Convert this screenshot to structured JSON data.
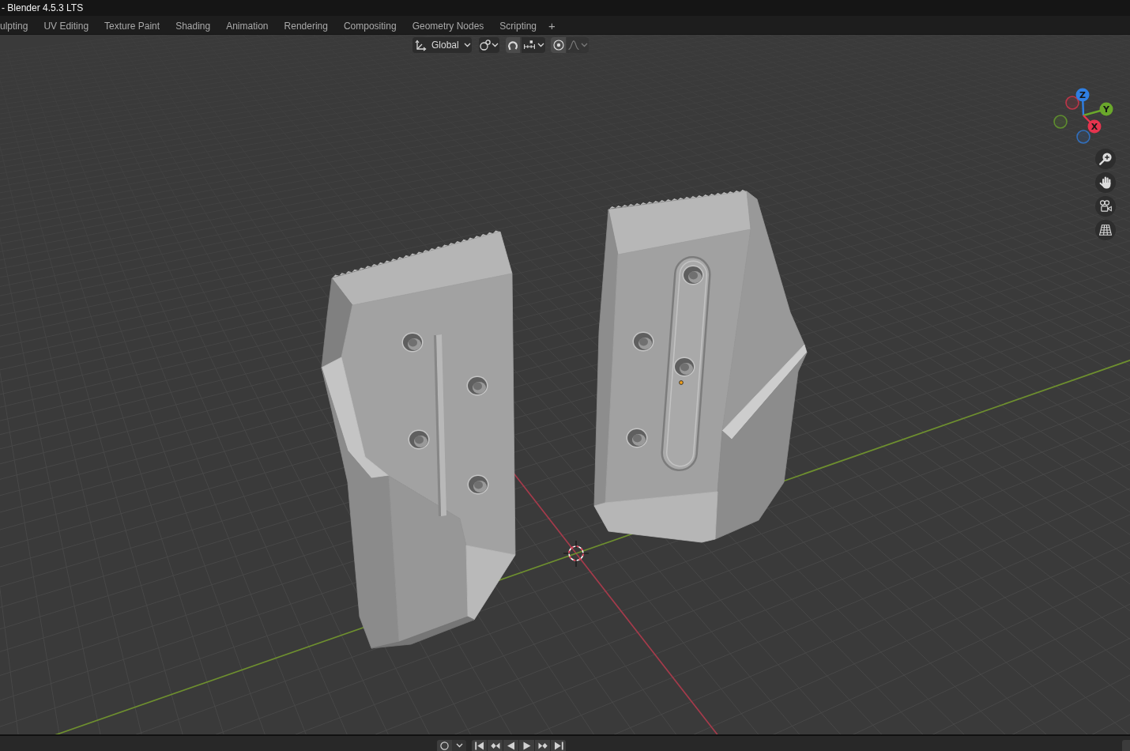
{
  "window": {
    "title": "- Blender 4.5.3 LTS"
  },
  "workspace_tabs": [
    {
      "label": "ulpting",
      "selected": false
    },
    {
      "label": "UV Editing",
      "selected": false
    },
    {
      "label": "Texture Paint",
      "selected": false
    },
    {
      "label": "Shading",
      "selected": false
    },
    {
      "label": "Animation",
      "selected": false
    },
    {
      "label": "Rendering",
      "selected": false
    },
    {
      "label": "Compositing",
      "selected": false
    },
    {
      "label": "Geometry Nodes",
      "selected": false
    },
    {
      "label": "Scripting",
      "selected": false
    }
  ],
  "add_workspace": {
    "label": "+"
  },
  "viewport_header": {
    "tools": [
      {
        "kind": "dropdown",
        "label": "Global",
        "disabled": false
      },
      {
        "kind": "dropdown",
        "disabled": false
      },
      {
        "kind": "toggle",
        "on": false,
        "disabled": false
      },
      {
        "kind": "dropdown",
        "disabled": false
      },
      {
        "kind": "toggle",
        "on": false,
        "disabled": false
      },
      {
        "kind": "dropdown",
        "disabled": true
      }
    ]
  },
  "navigation_gizmo": {
    "axes": [
      {
        "label": "Z",
        "color": "#2f7fe3"
      },
      {
        "label": "Y",
        "color": "#6aa72b"
      },
      {
        "label": "X",
        "color": "#e6344e"
      }
    ]
  },
  "timeline": {
    "record": {
      "on": false
    }
  }
}
